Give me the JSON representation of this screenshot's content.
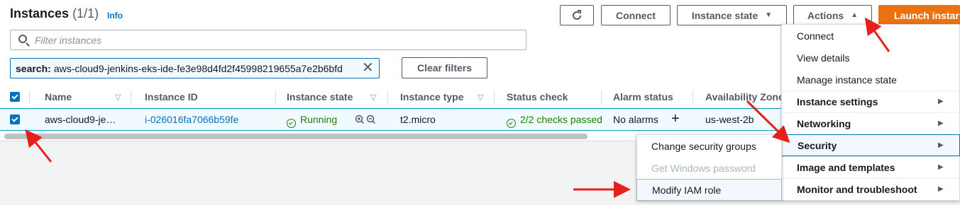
{
  "header": {
    "title": "Instances",
    "count": "(1/1)",
    "info_label": "Info",
    "connect_label": "Connect",
    "instance_state_label": "Instance state",
    "actions_label": "Actions",
    "launch_label": "Launch instan"
  },
  "filter": {
    "placeholder": "Filter instances",
    "token_key": "search:",
    "token_value": "aws-cloud9-jenkins-eks-ide-fe3e98d4fd2f45998219655a7e2b6bfd",
    "clear_label": "Clear filters"
  },
  "table": {
    "columns": [
      "Name",
      "Instance ID",
      "Instance state",
      "Instance type",
      "Status check",
      "Alarm status",
      "Availability Zone"
    ],
    "rows": [
      {
        "name": "aws-cloud9-je…",
        "instance_id": "i-026016fa7066b59fe",
        "state": "Running",
        "type": "t2.micro",
        "status_check": "2/2 checks passed",
        "alarm": "No alarms",
        "zone": "us-west-2b"
      }
    ]
  },
  "actions_menu": {
    "items": [
      "Connect",
      "View details",
      "Manage instance state"
    ],
    "submenus": [
      "Instance settings",
      "Networking",
      "Security",
      "Image and templates",
      "Monitor and troubleshoot"
    ]
  },
  "security_submenu": {
    "items": [
      "Change security groups",
      "Get Windows password",
      "Modify IAM role"
    ]
  },
  "colors": {
    "accent": "#0073bb",
    "primary": "#ec7211",
    "success": "#1d8102",
    "annotation": "#e8201c"
  }
}
